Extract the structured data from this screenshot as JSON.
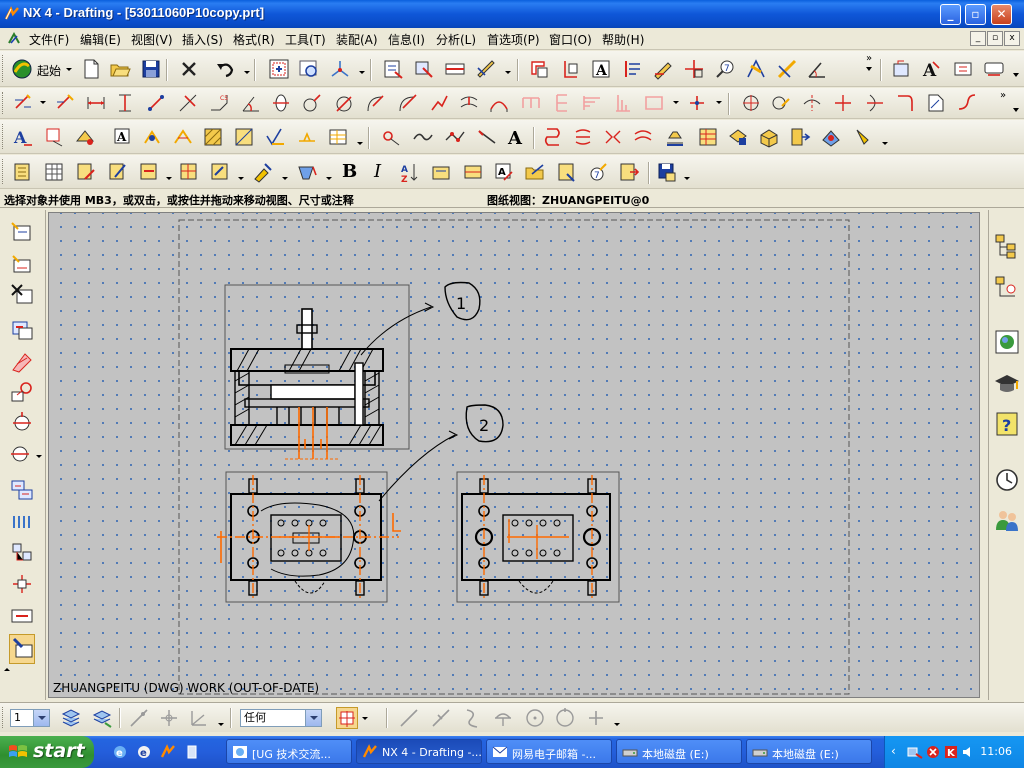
{
  "window": {
    "title": "NX 4 - Drafting - [53011060P10copy.prt]",
    "min_label": "_",
    "max_label": "▫",
    "close_label": "✕"
  },
  "menu": {
    "items": [
      "文件(F)",
      "编辑(E)",
      "视图(V)",
      "插入(S)",
      "格式(R)",
      "工具(T)",
      "装配(A)",
      "信息(I)",
      "分析(L)",
      "首选项(P)",
      "窗口(O)",
      "帮助(H)"
    ]
  },
  "toolbar": {
    "start_label": "起始",
    "bold_label": "B",
    "italic_label": "I",
    "note_label": "A"
  },
  "status": {
    "prompt": "选择对象并使用 MB3，或双击，或按住并拖动来移动视图、尺寸或注释",
    "sheet_view": "图纸视图：ZHUANGPEITU@0"
  },
  "canvas": {
    "view_name": "ZHUANGPEITU (DWG) WORK (OUT-OF-DATE)",
    "callout_1": "1",
    "callout_2": "2",
    "grid_color": "#3c6db4",
    "background": "#c2c2c2"
  },
  "bottombar": {
    "layer_value": "1",
    "filter_value": "任何"
  },
  "taskbar": {
    "start_label": "start",
    "tasks": [
      "[UG 技术交流...",
      "NX 4 - Drafting -...",
      "网易电子邮箱 -...",
      "本地磁盘 (E:)",
      "本地磁盘 (E:)"
    ],
    "active_task": 1,
    "clock": "11:06"
  }
}
